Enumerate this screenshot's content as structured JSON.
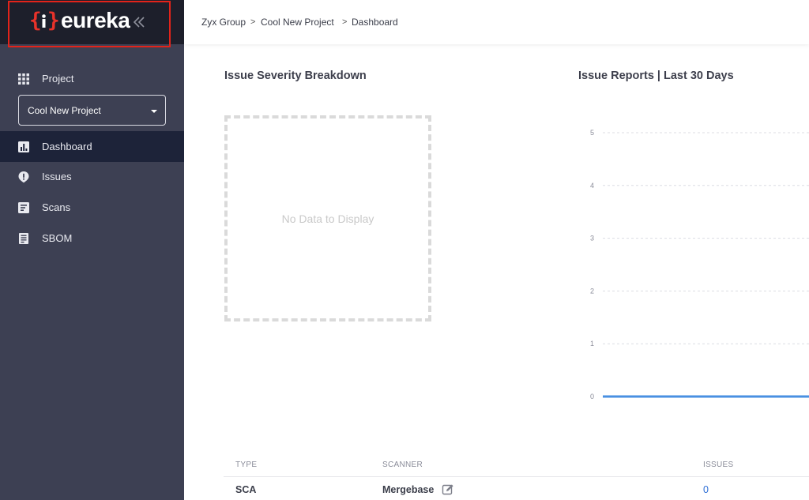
{
  "brand": {
    "logo_text": "eureka",
    "brace_left": "{",
    "brace_right": "}",
    "accent_color": "#e8322a"
  },
  "sidebar": {
    "project_label": "Project",
    "project_select_value": "Cool New Project",
    "items": [
      {
        "label": "Dashboard",
        "icon": "bar-chart-icon",
        "active": true
      },
      {
        "label": "Issues",
        "icon": "alert-badge-icon",
        "active": false
      },
      {
        "label": "Scans",
        "icon": "scan-doc-icon",
        "active": false
      },
      {
        "label": "SBOM",
        "icon": "receipt-icon",
        "active": false
      }
    ]
  },
  "breadcrumb": {
    "items": [
      "Zyx Group",
      "Cool New Project",
      "Dashboard"
    ],
    "separator": ">"
  },
  "severity": {
    "title": "Issue Severity Breakdown",
    "empty_text": "No Data to Display"
  },
  "reports": {
    "title": "Issue Reports | Last 30 Days"
  },
  "chart_data": {
    "type": "line",
    "title": "Issue Reports | Last 30 Days",
    "xlabel": "",
    "ylabel": "",
    "y_ticks": [
      "5",
      "4",
      "3",
      "2",
      "1",
      "0"
    ],
    "ylim": [
      0,
      5
    ],
    "grid": true,
    "series": [
      {
        "color": "#4a90e2",
        "values": [
          0,
          0
        ]
      }
    ]
  },
  "table": {
    "headers": [
      "TYPE",
      "SCANNER",
      "ISSUES"
    ],
    "rows": [
      {
        "type": "SCA",
        "scanner": "Mergebase",
        "issues": "0"
      }
    ]
  }
}
